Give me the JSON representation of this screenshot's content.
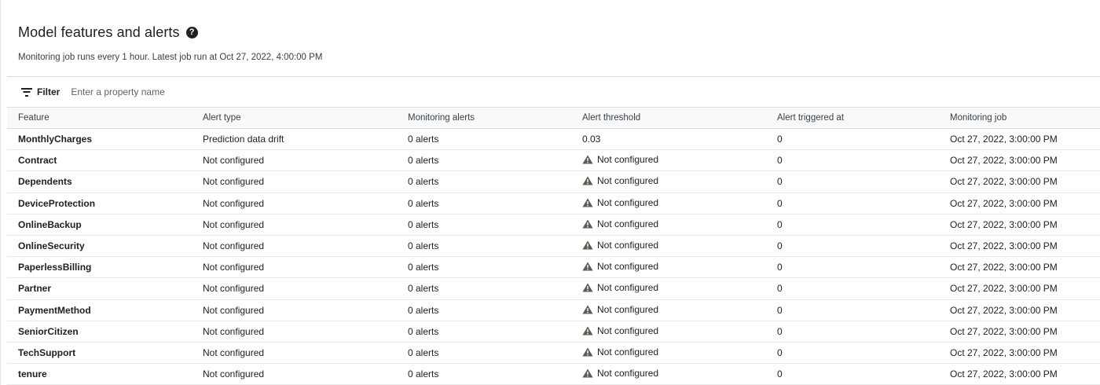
{
  "header": {
    "title": "Model features and alerts",
    "subtitle": "Monitoring job runs every 1 hour. Latest job run at Oct 27, 2022, 4:00:00 PM"
  },
  "filter": {
    "label": "Filter",
    "placeholder": "Enter a property name"
  },
  "table": {
    "columns": [
      "Feature",
      "Alert type",
      "Monitoring alerts",
      "Alert threshold",
      "Alert triggered at",
      "Monitoring job"
    ],
    "rows": [
      {
        "feature": "MonthlyCharges",
        "alert_type": "Prediction data drift",
        "alerts": "0 alerts",
        "threshold": "0.03",
        "threshold_warning": false,
        "triggered": "0",
        "job": "Oct 27, 2022, 3:00:00 PM"
      },
      {
        "feature": "Contract",
        "alert_type": "Not configured",
        "alerts": "0 alerts",
        "threshold": "Not configured",
        "threshold_warning": true,
        "triggered": "0",
        "job": "Oct 27, 2022, 3:00:00 PM"
      },
      {
        "feature": "Dependents",
        "alert_type": "Not configured",
        "alerts": "0 alerts",
        "threshold": "Not configured",
        "threshold_warning": true,
        "triggered": "0",
        "job": "Oct 27, 2022, 3:00:00 PM"
      },
      {
        "feature": "DeviceProtection",
        "alert_type": "Not configured",
        "alerts": "0 alerts",
        "threshold": "Not configured",
        "threshold_warning": true,
        "triggered": "0",
        "job": "Oct 27, 2022, 3:00:00 PM"
      },
      {
        "feature": "OnlineBackup",
        "alert_type": "Not configured",
        "alerts": "0 alerts",
        "threshold": "Not configured",
        "threshold_warning": true,
        "triggered": "0",
        "job": "Oct 27, 2022, 3:00:00 PM"
      },
      {
        "feature": "OnlineSecurity",
        "alert_type": "Not configured",
        "alerts": "0 alerts",
        "threshold": "Not configured",
        "threshold_warning": true,
        "triggered": "0",
        "job": "Oct 27, 2022, 3:00:00 PM"
      },
      {
        "feature": "PaperlessBilling",
        "alert_type": "Not configured",
        "alerts": "0 alerts",
        "threshold": "Not configured",
        "threshold_warning": true,
        "triggered": "0",
        "job": "Oct 27, 2022, 3:00:00 PM"
      },
      {
        "feature": "Partner",
        "alert_type": "Not configured",
        "alerts": "0 alerts",
        "threshold": "Not configured",
        "threshold_warning": true,
        "triggered": "0",
        "job": "Oct 27, 2022, 3:00:00 PM"
      },
      {
        "feature": "PaymentMethod",
        "alert_type": "Not configured",
        "alerts": "0 alerts",
        "threshold": "Not configured",
        "threshold_warning": true,
        "triggered": "0",
        "job": "Oct 27, 2022, 3:00:00 PM"
      },
      {
        "feature": "SeniorCitizen",
        "alert_type": "Not configured",
        "alerts": "0 alerts",
        "threshold": "Not configured",
        "threshold_warning": true,
        "triggered": "0",
        "job": "Oct 27, 2022, 3:00:00 PM"
      },
      {
        "feature": "TechSupport",
        "alert_type": "Not configured",
        "alerts": "0 alerts",
        "threshold": "Not configured",
        "threshold_warning": true,
        "triggered": "0",
        "job": "Oct 27, 2022, 3:00:00 PM"
      },
      {
        "feature": "tenure",
        "alert_type": "Not configured",
        "alerts": "0 alerts",
        "threshold": "Not configured",
        "threshold_warning": true,
        "triggered": "0",
        "job": "Oct 27, 2022, 3:00:00 PM"
      }
    ]
  },
  "icons": {
    "help": "help-circle-icon",
    "filter": "filter-list-icon",
    "warning": "warning-triangle-icon"
  },
  "colors": {
    "warning_icon": "#5f5a52",
    "header_bg": "#f8f9fa",
    "border": "#dadce0"
  }
}
